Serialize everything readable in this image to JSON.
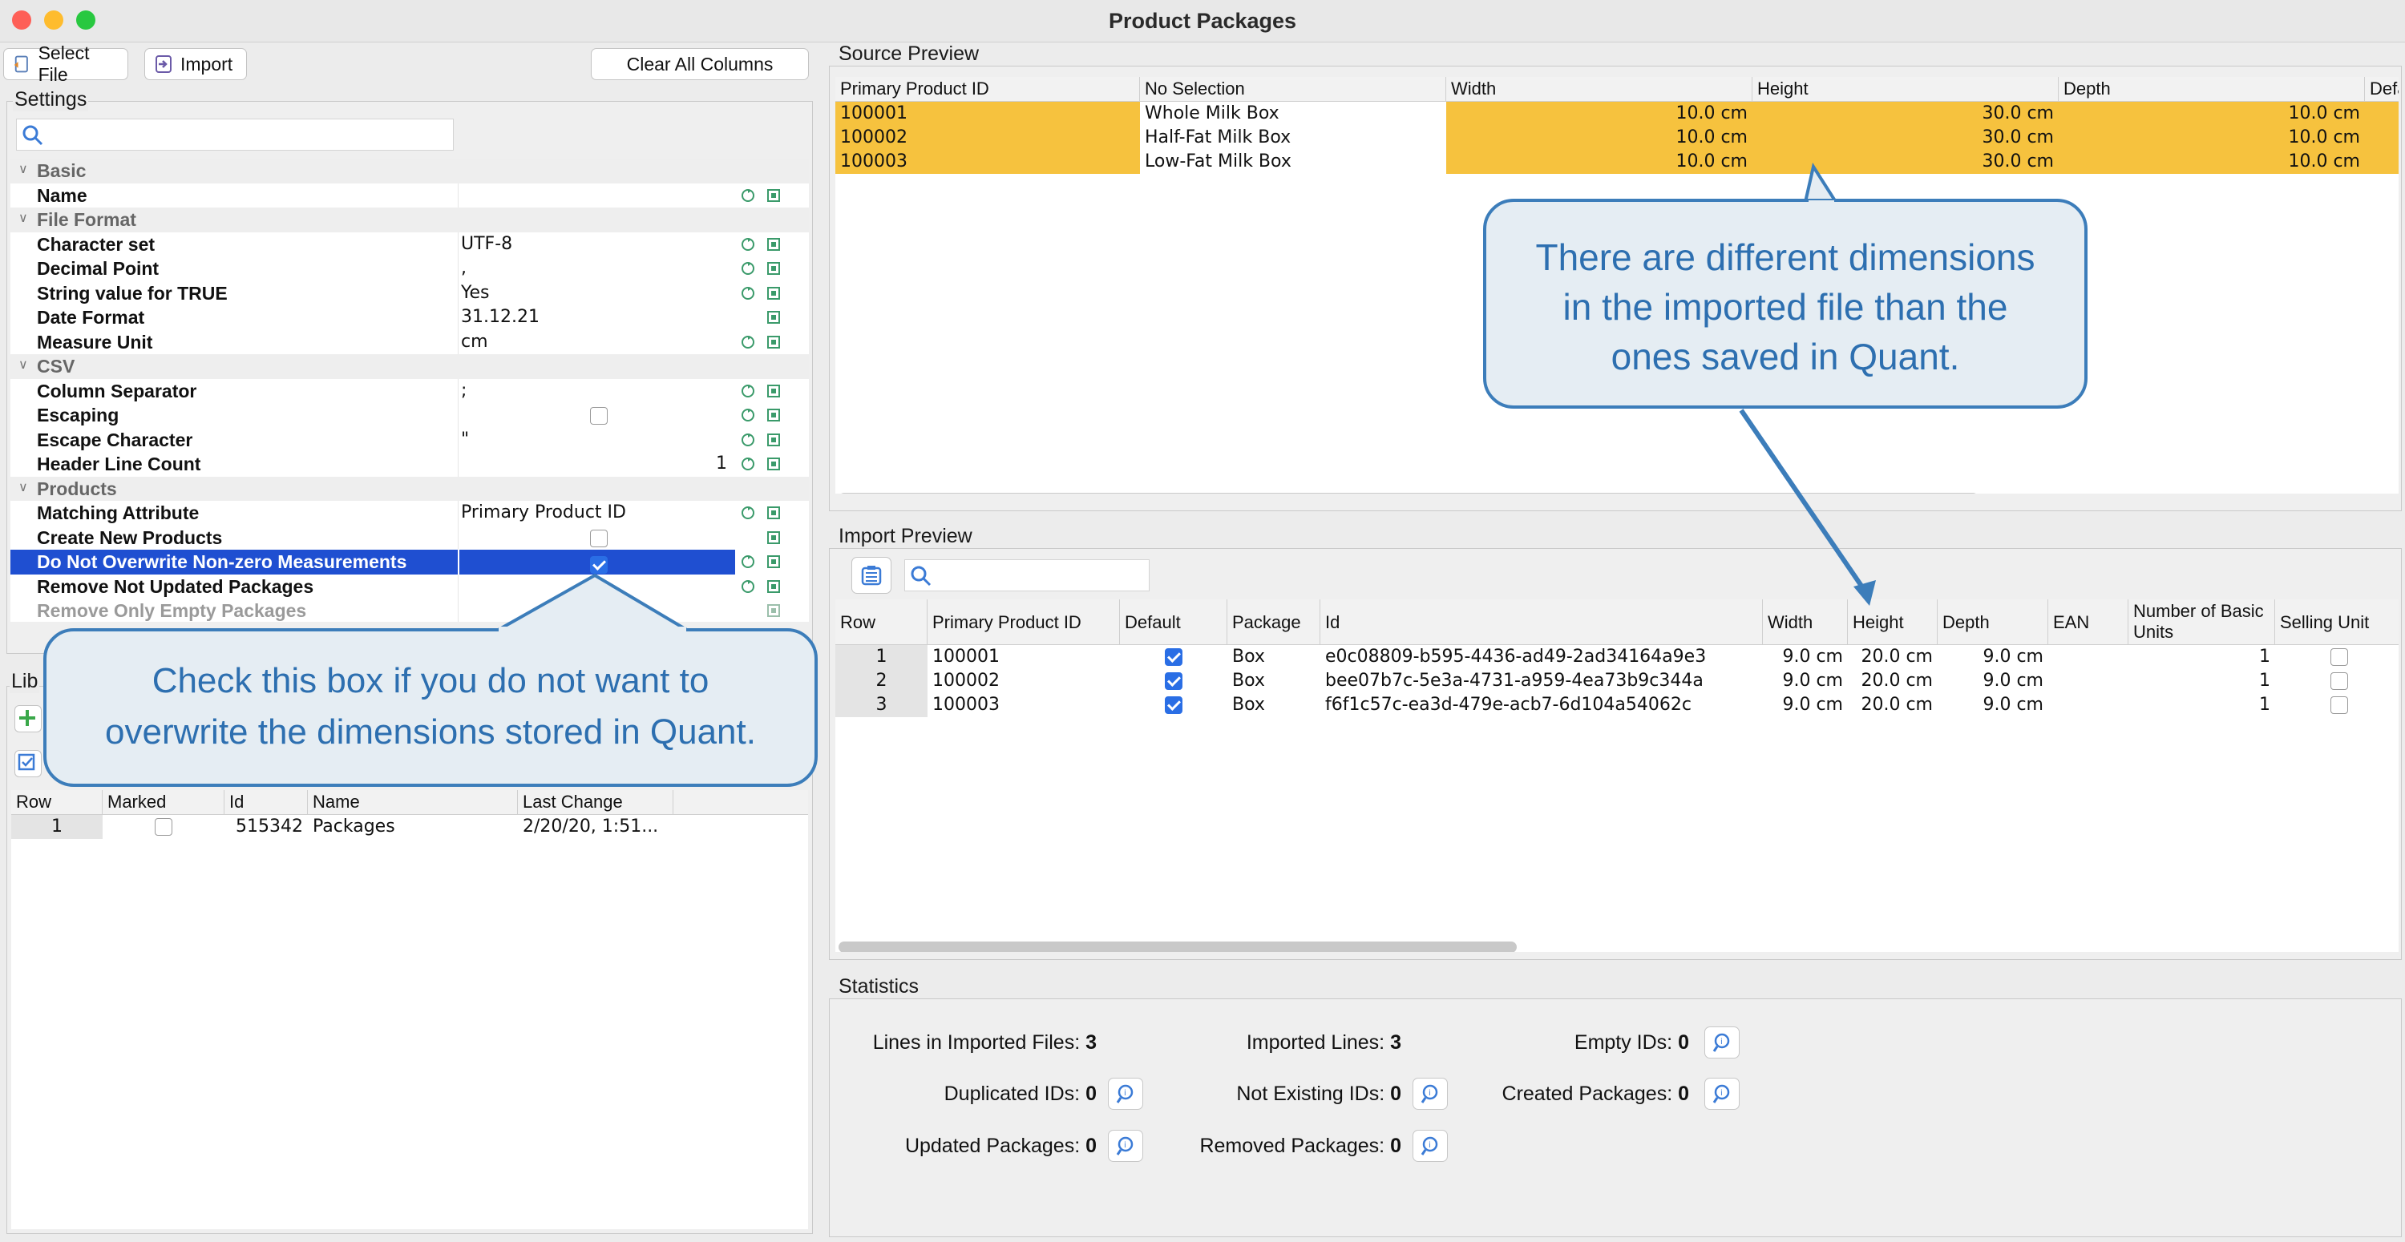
{
  "window": {
    "title": "Product Packages"
  },
  "toolbar": {
    "select_file": "Select File",
    "import": "Import",
    "clear_columns": "Clear All Columns"
  },
  "settings": {
    "legend": "Settings",
    "groups": [
      {
        "label": "Basic",
        "rows": [
          {
            "name": "Name",
            "value": ""
          }
        ]
      },
      {
        "label": "File Format",
        "rows": [
          {
            "name": "Character set",
            "value": "UTF-8"
          },
          {
            "name": "Decimal Point",
            "value": ","
          },
          {
            "name": "String value for TRUE",
            "value": "Yes"
          },
          {
            "name": "Date Format",
            "value": "31.12.21"
          },
          {
            "name": "Measure Unit",
            "value": "cm"
          }
        ]
      },
      {
        "label": "CSV",
        "rows": [
          {
            "name": "Column Separator",
            "value": ";"
          },
          {
            "name": "Escaping",
            "value": ""
          },
          {
            "name": "Escape Character",
            "value": "\""
          },
          {
            "name": "Header Line Count",
            "value": "1"
          }
        ]
      },
      {
        "label": "Products",
        "rows": [
          {
            "name": "Matching Attribute",
            "value": "Primary Product ID"
          },
          {
            "name": "Create New Products",
            "value": ""
          },
          {
            "name": "Do Not Overwrite Non-zero Measurements",
            "value": ""
          },
          {
            "name": "Remove Not Updated Packages",
            "value": ""
          },
          {
            "name": "Remove Only Empty Packages",
            "value": ""
          }
        ]
      }
    ]
  },
  "library": {
    "legend_partial": "Lib",
    "columns": [
      "Row",
      "Marked",
      "Id",
      "Name",
      "Last Change"
    ],
    "rows": [
      {
        "row": "1",
        "marked": false,
        "id": "515342",
        "name": "Packages",
        "last_change": "2/20/20, 1:51..."
      }
    ]
  },
  "source_preview": {
    "legend": "Source Preview",
    "columns": [
      "Primary Product ID",
      "No Selection",
      "Width",
      "Height",
      "Depth",
      "Defa"
    ],
    "rows": [
      [
        "100001",
        "Whole Milk Box",
        "10.0 cm",
        "30.0 cm",
        "10.0 cm"
      ],
      [
        "100002",
        "Half-Fat Milk Box",
        "10.0 cm",
        "30.0 cm",
        "10.0 cm"
      ],
      [
        "100003",
        "Low-Fat Milk Box",
        "10.0 cm",
        "30.0 cm",
        "10.0 cm"
      ]
    ]
  },
  "import_preview": {
    "legend": "Import Preview",
    "columns": [
      "Row",
      "Primary Product ID",
      "Default",
      "Package",
      "Id",
      "Width",
      "Height",
      "Depth",
      "EAN",
      "Number of Basic Units",
      "Selling Unit"
    ],
    "rows": [
      {
        "row": "1",
        "ppid": "100001",
        "package": "Box",
        "id": "e0c08809-b595-4436-ad49-2ad34164a9e3",
        "width": "9.0 cm",
        "height": "20.0 cm",
        "depth": "9.0 cm",
        "ean": "",
        "units": "1"
      },
      {
        "row": "2",
        "ppid": "100002",
        "package": "Box",
        "id": "bee07b7c-5e3a-4731-a959-4ea73b9c344a",
        "width": "9.0 cm",
        "height": "20.0 cm",
        "depth": "9.0 cm",
        "ean": "",
        "units": "1"
      },
      {
        "row": "3",
        "ppid": "100003",
        "package": "Box",
        "id": "f6f1c57c-ea3d-479e-acb7-6d104a54062c",
        "width": "9.0 cm",
        "height": "20.0 cm",
        "depth": "9.0 cm",
        "ean": "",
        "units": "1"
      }
    ]
  },
  "statistics": {
    "legend": "Statistics",
    "lines_imported": {
      "label": "Lines in Imported Files:",
      "value": "3"
    },
    "imported_lines": {
      "label": "Imported Lines:",
      "value": "3"
    },
    "empty_ids": {
      "label": "Empty IDs:",
      "value": "0"
    },
    "duplicated_ids": {
      "label": "Duplicated IDs:",
      "value": "0"
    },
    "not_existing_ids": {
      "label": "Not Existing IDs:",
      "value": "0"
    },
    "created_packages": {
      "label": "Created Packages:",
      "value": "0"
    },
    "updated_packages": {
      "label": "Updated Packages:",
      "value": "0"
    },
    "removed_packages": {
      "label": "Removed Packages:",
      "value": "0"
    }
  },
  "callouts": {
    "dimensions_line1": "There are different dimensions",
    "dimensions_line2": "in the imported file than the",
    "dimensions_line3": "ones saved in Quant.",
    "checkbox_line1": "Check this box if you do not want to",
    "checkbox_line2": "overwrite the dimensions stored in Quant."
  },
  "colors": {
    "accent_blue": "#2a6ee5",
    "selection": "#1f4fd1",
    "highlight_orange": "#f6c23e",
    "callout_border": "#3c7dba"
  }
}
